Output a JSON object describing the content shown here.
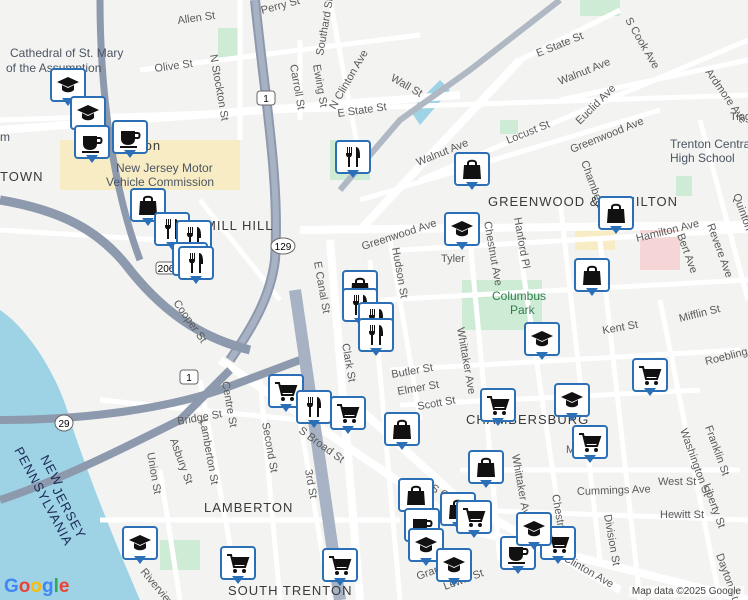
{
  "streets": {
    "allen": "Allen St",
    "perry": "Perry St",
    "southard": "Southard St",
    "olive": "Olive St",
    "n_stockton": "N Stockton St",
    "carroll": "Carroll St",
    "ewing": "Ewing St",
    "n_clinton": "N Clinton Ave",
    "e_state_top": "E State St",
    "e_state_mid": "E State St",
    "wall": "Wall St",
    "s_cook": "S Cook Ave",
    "walnut_top": "Walnut Ave",
    "walnut_mid": "Walnut Ave",
    "tioga": "Tioga St",
    "euclid": "Euclid Ave",
    "locust": "Locust St",
    "greenwood_top": "Greenwood Ave",
    "greenwood_mid": "Greenwood Ave",
    "ardmore": "Ardmore Ave",
    "chambers": "Chambers",
    "hamilton": "Hamilton Ave",
    "quinton": "Quinton",
    "bert": "Bert Ave",
    "revere": "Revere Ave",
    "hudson": "Hudson St",
    "chestnut": "Chestnut Ave",
    "hanford": "Hanford Pl",
    "tyler": "Tyler",
    "mifflin": "Mifflin St",
    "e_canal": "E Canal St",
    "clark": "Clark St",
    "whittaker": "Whittaker Ave",
    "kent": "Kent St",
    "butler": "Butler St",
    "elmer": "Elmer St",
    "scott": "Scott St",
    "roebling": "Roebling",
    "washington": "Washington St",
    "franklin": "Franklin St",
    "cooper": "Cooper St",
    "centre": "Centre St",
    "bridge": "Bridge St",
    "lamberton": "Lamberton St",
    "second": "Second St",
    "asbury": "Asbury St",
    "union": "Union St",
    "s_broad": "S Broad St",
    "third": "3rd St",
    "mott": "Mott",
    "cummings": "Cummings Ave",
    "west": "West St",
    "hewitt": "Hewitt St",
    "liberty": "Liberty St",
    "s_clinton": "S Clinton Ave",
    "s_clinton2": "S Clinton",
    "division": "Division St",
    "chestnut2": "Chestnut Ave",
    "whittaker2": "Whittaker Ave",
    "dayton": "Dayton St",
    "grand": "Grand St",
    "lewis": "Lewis St",
    "riverview": "Riverview"
  },
  "neighborhoods": {
    "greenwood_hamilton": "GREENWOOD & HAMILTON",
    "chambersburg": "CHAMBERSBURG",
    "lamberton": "LAMBERTON",
    "south_trenton": "SOUTH TRENTON",
    "mill_hill": "MILL HILL",
    "town": "TOWN",
    "downtown_partial": "ton"
  },
  "water_labels": {
    "state_new": "NEW",
    "state_jersey": "JERSEY",
    "pennsylvania": "PENNSYLVANIA"
  },
  "pois": {
    "cathedral": "Cathedral of St. Mary",
    "cathedral2": "of the Assumption",
    "njmvc1": "New Jersey Motor",
    "njmvc2": "Vehicle Commission",
    "trenton_central1": "Trenton Central",
    "trenton_central2": "High School",
    "columbus1": "Columbus",
    "columbus2": "Park",
    "museum": "m"
  },
  "route_shields": [
    "1",
    "129",
    "206",
    "1",
    "29",
    "129",
    "29"
  ],
  "markers": [
    {
      "kind": "school",
      "color": "#2b6fb7"
    },
    {
      "kind": "school"
    },
    {
      "kind": "cafe"
    },
    {
      "kind": "cafe"
    },
    {
      "kind": "restaurant"
    },
    {
      "kind": "shopping"
    },
    {
      "kind": "restaurant"
    },
    {
      "kind": "restaurant"
    },
    {
      "kind": "restaurant"
    },
    {
      "kind": "restaurant"
    },
    {
      "kind": "shopping"
    },
    {
      "kind": "shopping"
    },
    {
      "kind": "restaurant"
    },
    {
      "kind": "restaurant"
    },
    {
      "kind": "restaurant"
    },
    {
      "kind": "grocery"
    },
    {
      "kind": "restaurant"
    },
    {
      "kind": "grocery"
    },
    {
      "kind": "shopping"
    },
    {
      "kind": "school"
    },
    {
      "kind": "shopping"
    },
    {
      "kind": "shopping"
    },
    {
      "kind": "school"
    },
    {
      "kind": "shopping"
    },
    {
      "kind": "school"
    },
    {
      "kind": "grocery"
    },
    {
      "kind": "grocery"
    },
    {
      "kind": "school"
    },
    {
      "kind": "grocery"
    },
    {
      "kind": "shopping"
    },
    {
      "kind": "shopping"
    },
    {
      "kind": "grocery"
    },
    {
      "kind": "cafe"
    },
    {
      "kind": "school"
    },
    {
      "kind": "school"
    },
    {
      "kind": "cafe"
    },
    {
      "kind": "grocery"
    },
    {
      "kind": "school"
    },
    {
      "kind": "grocery"
    },
    {
      "kind": "grocery"
    }
  ],
  "google_logo": "Google",
  "attribution": "Map data ©2025 Google",
  "colors": {
    "marker_border": "#2b6fb7",
    "water": "#9ed3e6",
    "park": "#cdebd5",
    "highway": "#8d99ad",
    "road": "#ffffff"
  }
}
